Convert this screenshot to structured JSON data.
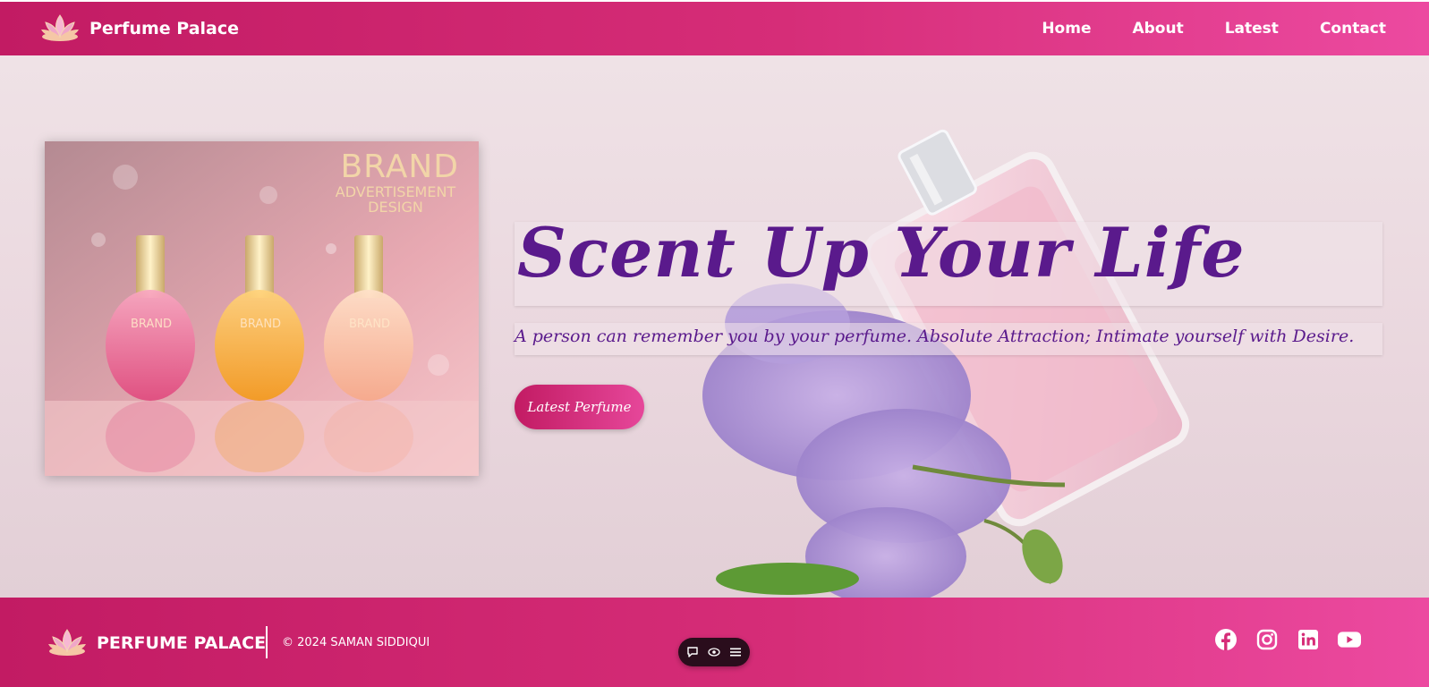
{
  "navbar": {
    "brand_name": "Perfume Palace",
    "logo_icon": "lotus-icon",
    "links": [
      {
        "label": "Home"
      },
      {
        "label": "About"
      },
      {
        "label": "Latest"
      },
      {
        "label": "Contact"
      }
    ]
  },
  "hero": {
    "ad": {
      "title": "BRAND",
      "subtitle": "ADVERTISEMENT DESIGN",
      "bottle_labels": [
        "BRAND",
        "BRAND",
        "BRAND"
      ]
    },
    "headline": "Scent Up Your Life",
    "tagline": "A person can remember you by your perfume. Absolute Attraction; Intimate yourself with Desire.",
    "cta_label": "Latest Perfume"
  },
  "footer": {
    "brand_name": "PERFUME PALACE",
    "copyright": "© 2024 SAMAN SIDDIQUI",
    "social_icons": [
      "facebook-icon",
      "instagram-icon",
      "linkedin-icon",
      "youtube-icon"
    ]
  },
  "floating_toolbar": {
    "icons": [
      "comment-icon",
      "eye-icon",
      "menu-icon"
    ]
  },
  "colors": {
    "primary": "#c21b63",
    "primary_light": "#ec4aa0",
    "headline": "#5a1a8c",
    "hero_bg": "#efe2e6"
  }
}
